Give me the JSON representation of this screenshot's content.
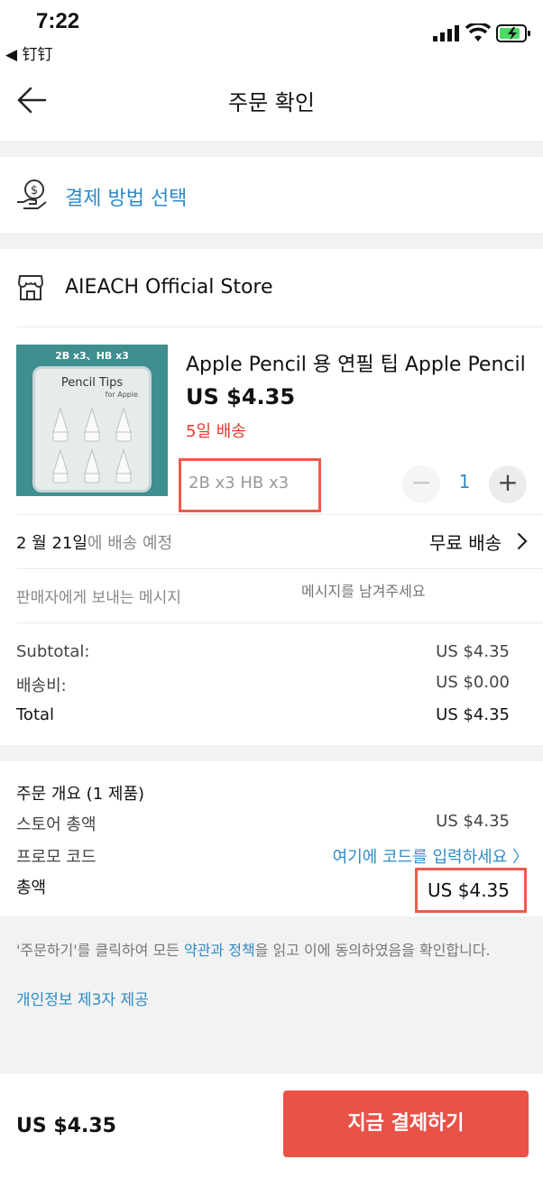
{
  "status_bar": {
    "time": "7:22",
    "back_app": "◀ 钉钉"
  },
  "header": {
    "title": "주문 확인"
  },
  "payment": {
    "label": "결제 방법 선택"
  },
  "store": {
    "name": "AIEACH Official Store"
  },
  "product": {
    "image_badge": "2B x3、HB x3",
    "image_title": "Pencil Tips",
    "image_subtitle": "for Apple",
    "title": "Apple Pencil 용 연필 팁 Apple Pencil",
    "price": "US $4.35",
    "delivery": "5일 배송",
    "variant": "2B x3 HB x3",
    "quantity": "1",
    "minus": "−",
    "plus": "+"
  },
  "shipping": {
    "date": "2 월 21일",
    "date_suffix": "에 배송 예정",
    "method": "무료 배송"
  },
  "message": {
    "label": "판매자에게 보내는 메시지",
    "placeholder": "메시지를 남겨주세요"
  },
  "summary": {
    "subtotal_label": "Subtotal:",
    "subtotal_value": "US $4.35",
    "shipping_label": "배송비:",
    "shipping_value": "US $0.00",
    "total_label": "Total",
    "total_value": "US $4.35"
  },
  "overview": {
    "title": "주문 개요 (1 제품)",
    "store_total_label": "스토어 총액",
    "store_total_value": "US $4.35",
    "promo_label": "프로모 코드",
    "promo_link": "여기에 코드를 입력하세요 〉",
    "grand_total_label": "총액",
    "grand_total_value": "US $4.35"
  },
  "terms": {
    "prefix": "'주문하기'를 클릭하여 모든 ",
    "link": "약관과 정책",
    "suffix": "을 읽고 이에 동의하였음을 확인합니다.",
    "privacy": "개인정보 제3자 제공"
  },
  "footer": {
    "price": "US $4.35",
    "button": "지금 결제하기"
  },
  "colors": {
    "accent_blue": "#2f8cc4",
    "primary_red": "#ea5247",
    "delivery_red": "#e23b2e",
    "highlight_border": "#ef5a4c"
  }
}
